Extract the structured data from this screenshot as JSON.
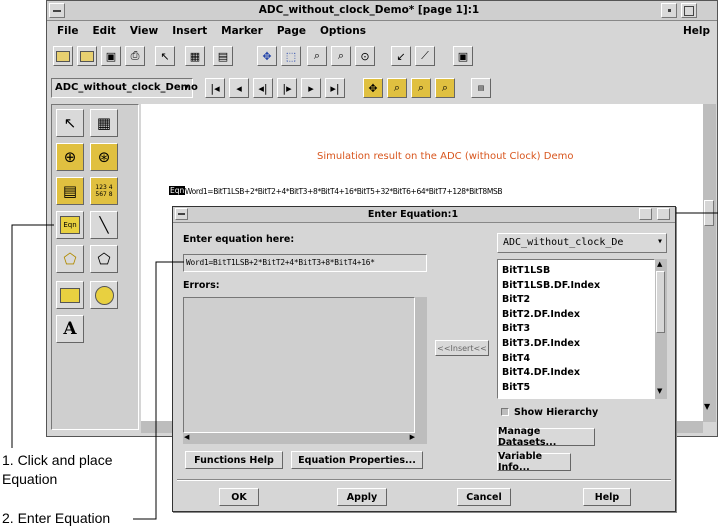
{
  "main_window": {
    "title": "ADC_without_clock_Demo* [page 1]:1",
    "menu": [
      "File",
      "Edit",
      "View",
      "Insert",
      "Marker",
      "Page",
      "Options"
    ],
    "help_menu": "Help",
    "dataset_selector": "ADC_without_clock_Demo",
    "plot_title": "Simulation result on the ADC (without Clock) Demo",
    "eqn_badge": "Eqn",
    "equation_text": "Word1=BitT1LSB+2*BitT2+4*BitT3+8*BitT4+16*BitT5+32*BitT6+64*BitT7+128*BitT8MSB"
  },
  "palette": {
    "eqn_tool": "Eqn",
    "text_tool": "A",
    "grid_tool_text": "123 4\n567 8"
  },
  "dialog": {
    "title": "Enter Equation:1",
    "prompt_label": "Enter equation here:",
    "equation_value": "Word1=BitT1LSB+2*BitT2+4*BitT3+8*BitT4+16*",
    "errors_label": "Errors:",
    "insert_button": "<<Insert<<",
    "dataset_select": "ADC_without_clock_De",
    "variables": [
      "BitT1LSB",
      "BitT1LSB.DF.Index",
      "BitT2",
      "BitT2.DF.Index",
      "BitT3",
      "BitT3.DF.Index",
      "BitT4",
      "BitT4.DF.Index",
      "BitT5"
    ],
    "show_hierarchy": "Show Hierarchy",
    "manage_datasets": "Manage Datasets...",
    "functions_help": "Functions Help",
    "equation_properties": "Equation Properties...",
    "variable_info": "Variable Info...",
    "ok": "OK",
    "apply": "Apply",
    "cancel": "Cancel",
    "help": "Help"
  },
  "annotations": {
    "step1": "1. Click and place\nEquation",
    "step2": "2. Enter Equation"
  }
}
